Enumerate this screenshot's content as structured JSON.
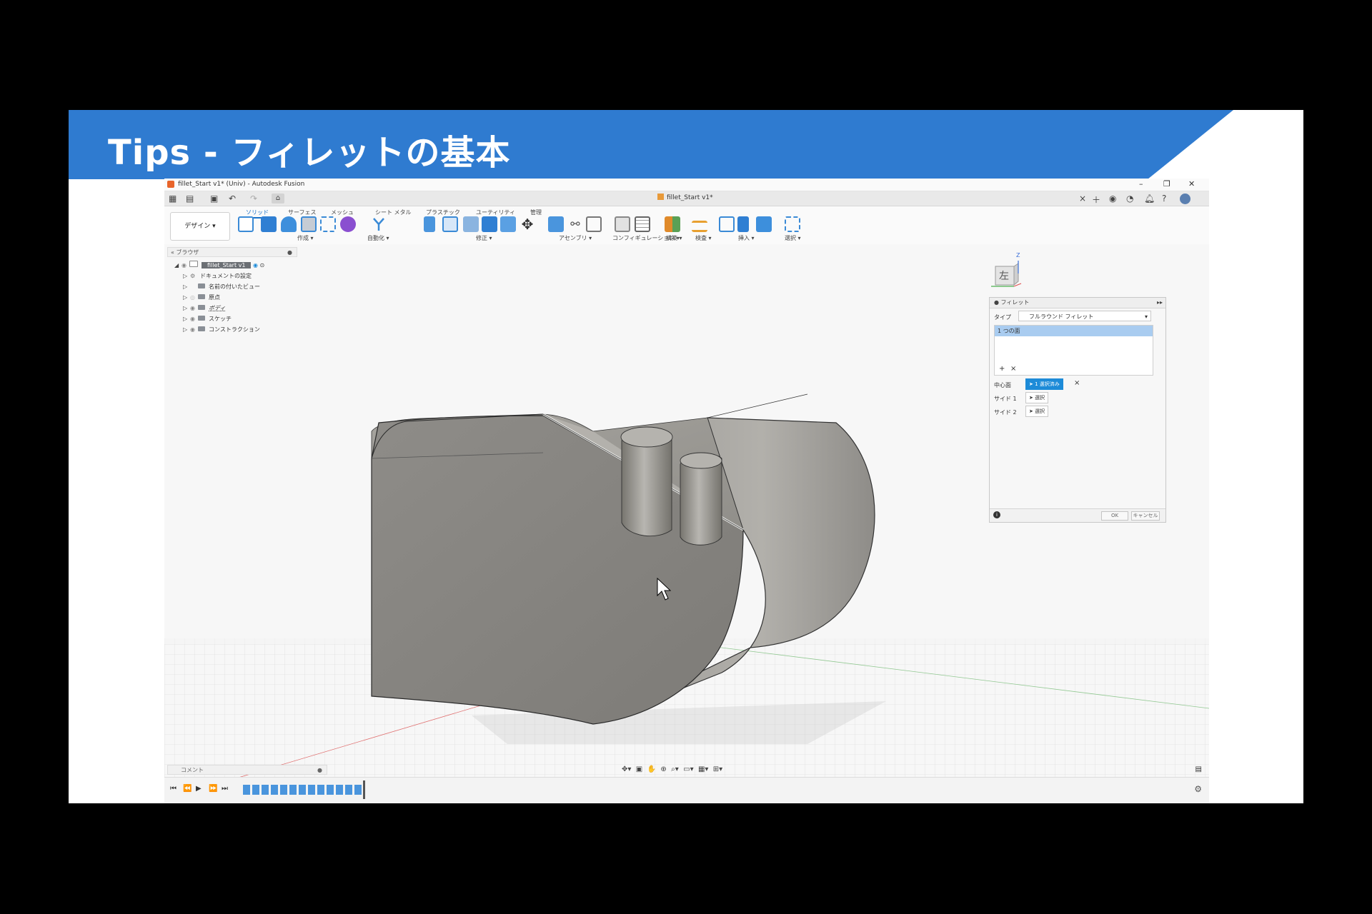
{
  "slide": {
    "title": "Tips - フィレットの基本"
  },
  "window": {
    "title": "fillet_Start v1* (Univ) - Autodesk Fusion",
    "doc_tab": "fillet_Start v1*",
    "workspace": "デザイン ▾",
    "ribbon_tabs": [
      "ソリッド",
      "サーフェス",
      "メッシュ",
      "シート メタル",
      "プラスチック",
      "ユーティリティ",
      "管理"
    ],
    "groups": [
      "作成 ▾",
      "自動化 ▾",
      "修正 ▾",
      "アセンブリ ▾",
      "コンフィギュレーション ▾",
      "構築 ▾",
      "検査 ▾",
      "挿入 ▾",
      "選択 ▾"
    ]
  },
  "browser": {
    "header": "ブラウザ",
    "root": "fillet_Start v1",
    "items": [
      "ドキュメントの設定",
      "名前の付いたビュー",
      "原点",
      "ボディ",
      "スケッチ",
      "コンストラクション"
    ]
  },
  "viewcube": {
    "face": "左",
    "axis": "Z"
  },
  "fillet_panel": {
    "title": "フィレット",
    "type_label": "タイプ",
    "type_value": "フルラウンド フィレット",
    "list_item": "1 つの面",
    "center_label": "中心面",
    "center_value": "1 選択済み",
    "side1_label": "サイド 1",
    "side2_label": "サイド 2",
    "select_label": "選択",
    "ok": "OK",
    "cancel": "キャンセル"
  },
  "comment": {
    "label": "コメント"
  },
  "colors": {
    "banner": "#2f7bd0",
    "accent": "#1d8bd8"
  }
}
